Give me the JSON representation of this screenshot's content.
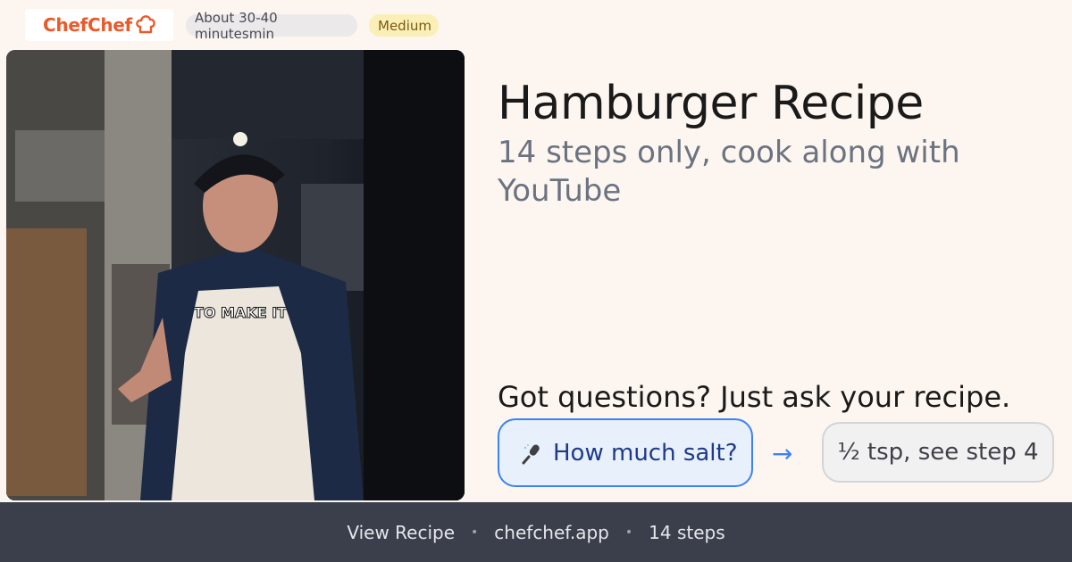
{
  "brand": {
    "name": "ChefChef",
    "logo_icon": "chef-hat-icon",
    "color": "#ea5a2a"
  },
  "badges": {
    "time": "About 30-40 minutesmin",
    "difficulty": "Medium"
  },
  "photo": {
    "overlay_caption": "TO MAKE IT"
  },
  "recipe": {
    "title": "Hamburger Recipe",
    "subtitle": "14 steps only, cook along with YouTube"
  },
  "qa": {
    "prompt": "Got questions? Just ask your recipe.",
    "question": "How much salt?",
    "question_icon": "microphone-icon",
    "arrow": "→",
    "answer": "½ tsp, see step 4",
    "accent": "#3b82f6"
  },
  "footer": {
    "items": [
      "View Recipe",
      "chefchef.app",
      "14 steps"
    ],
    "separator": "•"
  }
}
